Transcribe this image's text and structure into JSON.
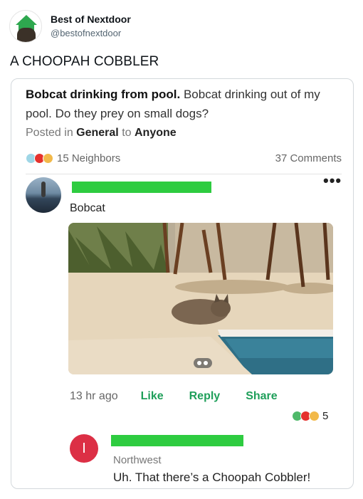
{
  "tweet": {
    "display_name": "Best of Nextdoor",
    "handle": "@bestofnextdoor",
    "text": "A CHOOPAH COBBLER"
  },
  "post": {
    "title": "Bobcat drinking from pool.",
    "body": " Bobcat drinking out of my pool. Do they prey on small dogs?",
    "posted_prefix": "Posted in ",
    "category": "General",
    "to_word": " to ",
    "audience": "Anyone",
    "reactions_label": "15 Neighbors",
    "comments_label": "37 Comments"
  },
  "comment": {
    "more_label": "•••",
    "body": "Bobcat",
    "time": "13 hr ago",
    "like_label": "Like",
    "reply_label": "Reply",
    "share_label": "Share",
    "reaction_count": "5"
  },
  "reply": {
    "avatar_letter": "I",
    "location": "Northwest",
    "body": "Uh. That there’s a Choopah Cobbler!"
  },
  "colors": {
    "accent_green": "#1f9f5a",
    "redaction_green": "#2ecc40",
    "reply_avatar": "#dc2f45"
  },
  "icons": {
    "avatar": "nextdoor-house-avatar",
    "more": "more-options-icon",
    "reactions": [
      "wow-emoji",
      "heart-emoji",
      "laugh-emoji"
    ]
  }
}
